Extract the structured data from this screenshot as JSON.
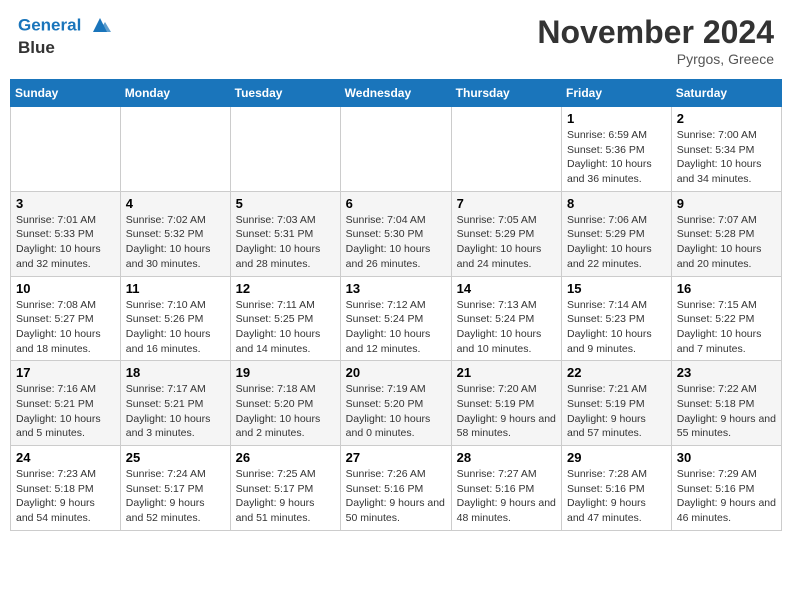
{
  "header": {
    "logo_line1": "General",
    "logo_line2": "Blue",
    "month": "November 2024",
    "location": "Pyrgos, Greece"
  },
  "weekdays": [
    "Sunday",
    "Monday",
    "Tuesday",
    "Wednesday",
    "Thursday",
    "Friday",
    "Saturday"
  ],
  "weeks": [
    [
      {
        "day": "",
        "info": ""
      },
      {
        "day": "",
        "info": ""
      },
      {
        "day": "",
        "info": ""
      },
      {
        "day": "",
        "info": ""
      },
      {
        "day": "",
        "info": ""
      },
      {
        "day": "1",
        "info": "Sunrise: 6:59 AM\nSunset: 5:36 PM\nDaylight: 10 hours and 36 minutes."
      },
      {
        "day": "2",
        "info": "Sunrise: 7:00 AM\nSunset: 5:34 PM\nDaylight: 10 hours and 34 minutes."
      }
    ],
    [
      {
        "day": "3",
        "info": "Sunrise: 7:01 AM\nSunset: 5:33 PM\nDaylight: 10 hours and 32 minutes."
      },
      {
        "day": "4",
        "info": "Sunrise: 7:02 AM\nSunset: 5:32 PM\nDaylight: 10 hours and 30 minutes."
      },
      {
        "day": "5",
        "info": "Sunrise: 7:03 AM\nSunset: 5:31 PM\nDaylight: 10 hours and 28 minutes."
      },
      {
        "day": "6",
        "info": "Sunrise: 7:04 AM\nSunset: 5:30 PM\nDaylight: 10 hours and 26 minutes."
      },
      {
        "day": "7",
        "info": "Sunrise: 7:05 AM\nSunset: 5:29 PM\nDaylight: 10 hours and 24 minutes."
      },
      {
        "day": "8",
        "info": "Sunrise: 7:06 AM\nSunset: 5:29 PM\nDaylight: 10 hours and 22 minutes."
      },
      {
        "day": "9",
        "info": "Sunrise: 7:07 AM\nSunset: 5:28 PM\nDaylight: 10 hours and 20 minutes."
      }
    ],
    [
      {
        "day": "10",
        "info": "Sunrise: 7:08 AM\nSunset: 5:27 PM\nDaylight: 10 hours and 18 minutes."
      },
      {
        "day": "11",
        "info": "Sunrise: 7:10 AM\nSunset: 5:26 PM\nDaylight: 10 hours and 16 minutes."
      },
      {
        "day": "12",
        "info": "Sunrise: 7:11 AM\nSunset: 5:25 PM\nDaylight: 10 hours and 14 minutes."
      },
      {
        "day": "13",
        "info": "Sunrise: 7:12 AM\nSunset: 5:24 PM\nDaylight: 10 hours and 12 minutes."
      },
      {
        "day": "14",
        "info": "Sunrise: 7:13 AM\nSunset: 5:24 PM\nDaylight: 10 hours and 10 minutes."
      },
      {
        "day": "15",
        "info": "Sunrise: 7:14 AM\nSunset: 5:23 PM\nDaylight: 10 hours and 9 minutes."
      },
      {
        "day": "16",
        "info": "Sunrise: 7:15 AM\nSunset: 5:22 PM\nDaylight: 10 hours and 7 minutes."
      }
    ],
    [
      {
        "day": "17",
        "info": "Sunrise: 7:16 AM\nSunset: 5:21 PM\nDaylight: 10 hours and 5 minutes."
      },
      {
        "day": "18",
        "info": "Sunrise: 7:17 AM\nSunset: 5:21 PM\nDaylight: 10 hours and 3 minutes."
      },
      {
        "day": "19",
        "info": "Sunrise: 7:18 AM\nSunset: 5:20 PM\nDaylight: 10 hours and 2 minutes."
      },
      {
        "day": "20",
        "info": "Sunrise: 7:19 AM\nSunset: 5:20 PM\nDaylight: 10 hours and 0 minutes."
      },
      {
        "day": "21",
        "info": "Sunrise: 7:20 AM\nSunset: 5:19 PM\nDaylight: 9 hours and 58 minutes."
      },
      {
        "day": "22",
        "info": "Sunrise: 7:21 AM\nSunset: 5:19 PM\nDaylight: 9 hours and 57 minutes."
      },
      {
        "day": "23",
        "info": "Sunrise: 7:22 AM\nSunset: 5:18 PM\nDaylight: 9 hours and 55 minutes."
      }
    ],
    [
      {
        "day": "24",
        "info": "Sunrise: 7:23 AM\nSunset: 5:18 PM\nDaylight: 9 hours and 54 minutes."
      },
      {
        "day": "25",
        "info": "Sunrise: 7:24 AM\nSunset: 5:17 PM\nDaylight: 9 hours and 52 minutes."
      },
      {
        "day": "26",
        "info": "Sunrise: 7:25 AM\nSunset: 5:17 PM\nDaylight: 9 hours and 51 minutes."
      },
      {
        "day": "27",
        "info": "Sunrise: 7:26 AM\nSunset: 5:16 PM\nDaylight: 9 hours and 50 minutes."
      },
      {
        "day": "28",
        "info": "Sunrise: 7:27 AM\nSunset: 5:16 PM\nDaylight: 9 hours and 48 minutes."
      },
      {
        "day": "29",
        "info": "Sunrise: 7:28 AM\nSunset: 5:16 PM\nDaylight: 9 hours and 47 minutes."
      },
      {
        "day": "30",
        "info": "Sunrise: 7:29 AM\nSunset: 5:16 PM\nDaylight: 9 hours and 46 minutes."
      }
    ]
  ]
}
